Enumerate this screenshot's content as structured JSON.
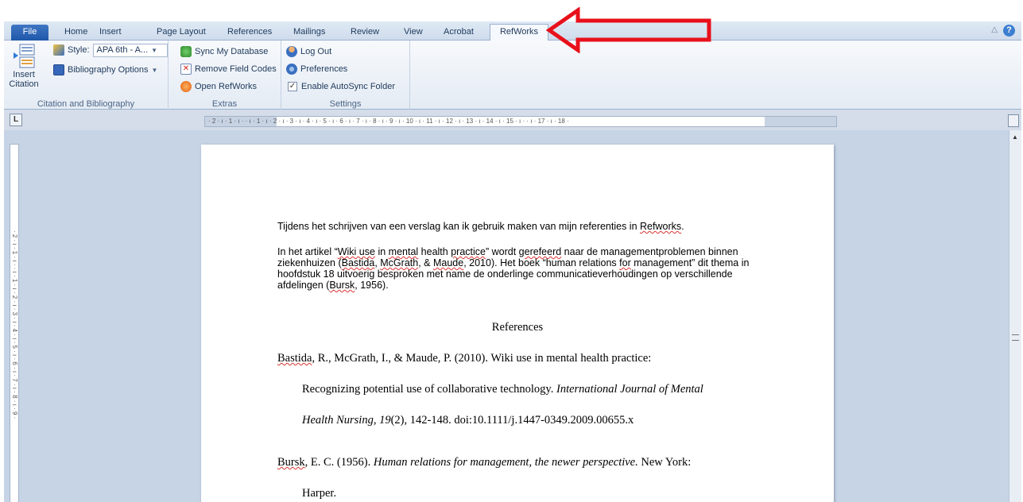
{
  "tabs": {
    "file": "File",
    "home": "Home",
    "insert": "Insert",
    "page_layout": "Page Layout",
    "references": "References",
    "mailings": "Mailings",
    "review": "Review",
    "view": "View",
    "acrobat": "Acrobat",
    "refworks": "RefWorks"
  },
  "ribbon": {
    "citation_group": {
      "insert_citation": "Insert Citation",
      "style_label": "Style:",
      "style_value": "APA 6th - A...",
      "bibliography_options": "Bibliography Options",
      "label": "Citation and Bibliography"
    },
    "extras_group": {
      "sync_db": "Sync My Database",
      "remove_field_codes": "Remove Field Codes",
      "open_refworks": "Open RefWorks",
      "label": "Extras"
    },
    "settings_group": {
      "log_out": "Log Out",
      "preferences": "Preferences",
      "enable_autosync": "Enable AutoSync Folder",
      "autosync_checked": true,
      "label": "Settings"
    }
  },
  "ruler": {
    "corner": "L",
    "scale": "· 2 · ı · 1 · ı ·  · ı · 1 · ı · 2 · ı · 3 · ı · 4 · ı · 5 · ı · 6 · ı · 7 · ı · 8 · ı · 9 · ı · 10 · ı · 11 · ı · 12 · ı · 13 · ı · 14 · ı · 15 · ı ·  · ı · 17 · ı · 18 ·",
    "vscale": "· 2 · ı · 1 · ı ·  · ı · 1 · ı · 2 · ı · 3 · ı · 4 · ı · 5 · ı · 6 · ı · 7 · ı · 8 · ı · 9 ·"
  },
  "document": {
    "p1": [
      "Tijdens het schrijven van een verslag kan ik gebruik maken van mijn referenties in ",
      "Refworks",
      "."
    ],
    "p2": {
      "a": "In het artikel “",
      "b": "Wiki use",
      "c": " in ",
      "d": "mental",
      "e": " health ",
      "f": "practice",
      "g": "”  wordt ",
      "h": "gerefeerd",
      "i": " naar de managementproblemen binnen ziekenhuizen  (",
      "j": "Bastida",
      "k": ", ",
      "l": "McGrath",
      "m": ", & ",
      "n": "Maude",
      "o": ", 2010).  Het boek “human relations ",
      "p": "for",
      "q": " management”  dit thema in hoofdstuk 18 uitvoerig besproken met name  de onderlinge communicatieverhoudingen  op verschillende afdelingen (",
      "r": "Bursk",
      "s": ", 1956)."
    },
    "references_heading": "References",
    "ref1": {
      "line1_author": "Bastida",
      "line1_rest": ", R., McGrath, I., & Maude, P. (2010). Wiki use in mental health practice:",
      "line2_plain": "Recognizing potential use of collaborative technology. ",
      "line2_italic": "International  Journal of Mental",
      "line3_italic_a": "Health Nursing, 19",
      "line3_plain": "(2), 142-148. doi:10.1111/j.1447-0349.2009.00655.x"
    },
    "ref2": {
      "line1_author": "Bursk",
      "line1_plain": ", E. C. (1956). ",
      "line1_italic": "Human relations for management, the newer perspective.",
      "line1_end": "  New York:",
      "line2": "Harper."
    }
  },
  "colors": {
    "annotation_arrow": "#e8101a",
    "file_tab": "#2a62b2",
    "workspace": "#c6d4e6"
  }
}
